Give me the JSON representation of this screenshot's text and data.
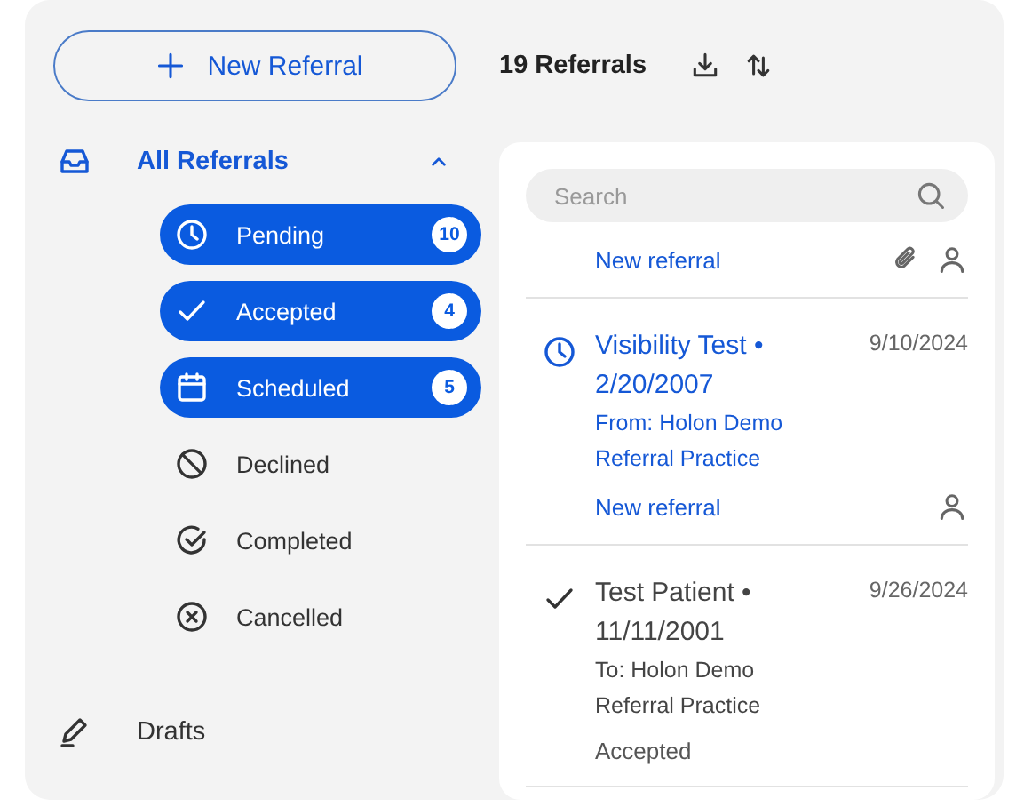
{
  "new_referral_button": {
    "label": "New Referral"
  },
  "header": {
    "count": "19 Referrals"
  },
  "folders": [
    {
      "label": "All Referrals",
      "kind": "inbox",
      "expanded": true,
      "children": [
        {
          "label": "Pending",
          "kind": "pending",
          "selected": true,
          "count": "10"
        },
        {
          "label": "Accepted",
          "kind": "accepted",
          "selected": true,
          "count": "4"
        },
        {
          "label": "Scheduled",
          "kind": "scheduled",
          "selected": true,
          "count": "5"
        },
        {
          "label": "Declined",
          "kind": "declined",
          "selected": false
        },
        {
          "label": "Completed",
          "kind": "completed",
          "selected": false
        },
        {
          "label": "Cancelled",
          "kind": "cancelled",
          "selected": false
        }
      ]
    },
    {
      "label": "Drafts",
      "kind": "drafts"
    }
  ],
  "search": {
    "placeholder": "Search"
  },
  "referrals": [
    {
      "status": "New referral",
      "highlighted": true,
      "attachment": true,
      "assignee": true
    },
    {
      "kind": "pending",
      "title": "Visibility Test • 2/20/2007",
      "date": "9/10/2024",
      "practice": "From: Holon Demo Referral Practice",
      "status": "New referral",
      "highlighted": true,
      "attachment": false,
      "assignee": true
    },
    {
      "kind": "accepted",
      "title": "Test Patient • 11/11/2001",
      "date": "9/26/2024",
      "practice": "To: Holon Demo Referral Practice",
      "status": "Accepted",
      "highlighted": false,
      "attachment": false,
      "assignee": false
    }
  ]
}
